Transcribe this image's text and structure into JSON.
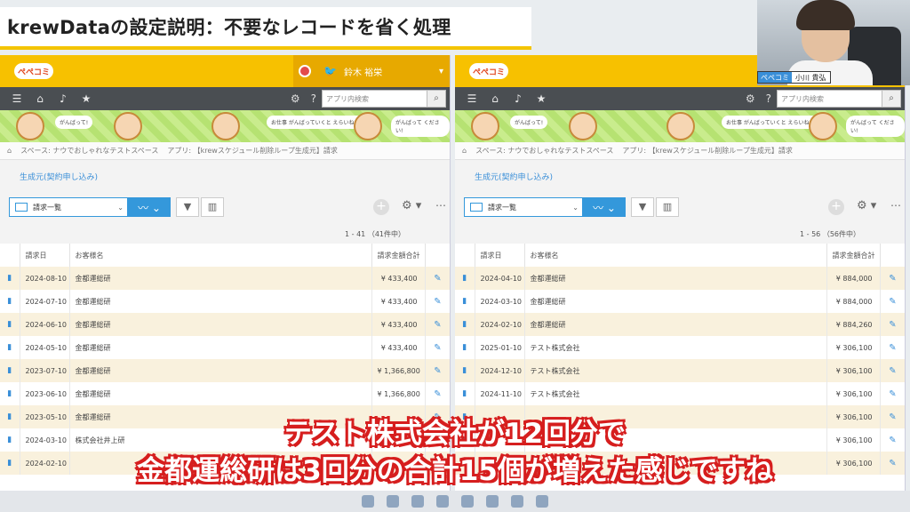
{
  "title": "krewDataの設定説明：不要なレコードを省く処理",
  "app": {
    "logo": "ぺぺコミ",
    "user_name": "鈴木 裕栄",
    "search_placeholder": "アプリ内検索",
    "breadcrumb_space": "スペース: ナウでおしゃれなテストスペース",
    "breadcrumb_app": "アプリ: 【krewスケジュール削除ループ生成元】請求",
    "subtitle": "生成元(契約申し込み)",
    "view_name": "請求一覧",
    "columns": [
      "請求日",
      "お客様名",
      "請求金額合計"
    ]
  },
  "banner": {
    "bubble1": "がんばって!",
    "bubble2": "お仕事 がんばっていくと えらいね。",
    "bubble3": "がんばって ください!"
  },
  "left": {
    "count": "1 - 41 （41件中）",
    "rows": [
      {
        "date": "2024-08-10",
        "customer": "金都運総研",
        "amount": "¥ 433,400"
      },
      {
        "date": "2024-07-10",
        "customer": "金都運総研",
        "amount": "¥ 433,400"
      },
      {
        "date": "2024-06-10",
        "customer": "金都運総研",
        "amount": "¥ 433,400"
      },
      {
        "date": "2024-05-10",
        "customer": "金都運総研",
        "amount": "¥ 433,400"
      },
      {
        "date": "2023-07-10",
        "customer": "金都運総研",
        "amount": "¥ 1,366,800"
      },
      {
        "date": "2023-06-10",
        "customer": "金都運総研",
        "amount": "¥ 1,366,800"
      },
      {
        "date": "2023-05-10",
        "customer": "金都運総研",
        "amount": ""
      },
      {
        "date": "2024-03-10",
        "customer": "株式会社井上研",
        "amount": ""
      },
      {
        "date": "2024-02-10",
        "customer": "",
        "amount": ""
      }
    ]
  },
  "right": {
    "count": "1 - 56 （56件中）",
    "rows": [
      {
        "date": "2024-04-10",
        "customer": "金都運総研",
        "amount": "¥ 884,000"
      },
      {
        "date": "2024-03-10",
        "customer": "金都運総研",
        "amount": "¥ 884,000"
      },
      {
        "date": "2024-02-10",
        "customer": "金都運総研",
        "amount": "¥ 884,260"
      },
      {
        "date": "2025-01-10",
        "customer": "テスト株式会社",
        "amount": "¥ 306,100"
      },
      {
        "date": "2024-12-10",
        "customer": "テスト株式会社",
        "amount": "¥ 306,100"
      },
      {
        "date": "2024-11-10",
        "customer": "テスト株式会社",
        "amount": "¥ 306,100"
      },
      {
        "date": "",
        "customer": "",
        "amount": "¥ 306,100"
      },
      {
        "date": "",
        "customer": "",
        "amount": "¥ 306,100"
      },
      {
        "date": "",
        "customer": "",
        "amount": "¥ 306,100"
      }
    ]
  },
  "webcam": {
    "brand": "ぺぺコミ",
    "name": "小川 貴弘"
  },
  "caption": {
    "line1": "テスト株式会社が12回分で",
    "line2": "金都運総研は3回分の合計15個が増えた感じですね"
  }
}
